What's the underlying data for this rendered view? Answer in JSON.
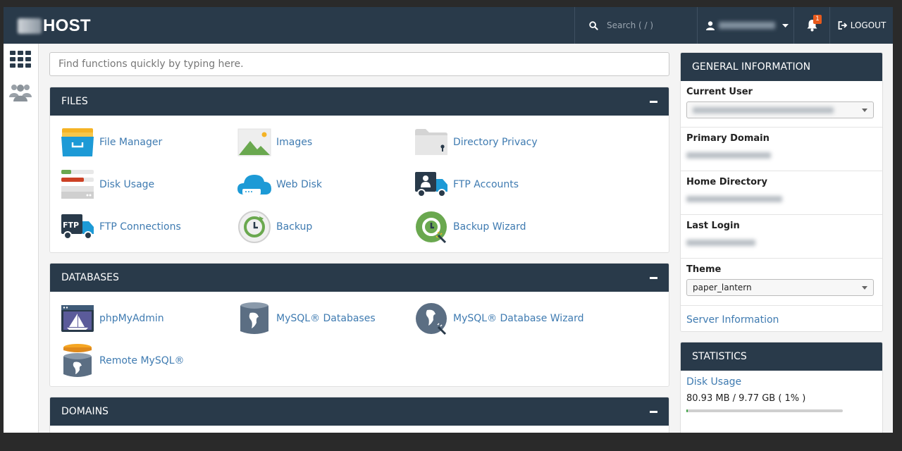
{
  "header": {
    "logo_text": "HOST",
    "search_placeholder": "Search ( / )",
    "notification_count": "1",
    "logout_label": "LOGOUT"
  },
  "quick_search": {
    "placeholder": "Find functions quickly by typing here."
  },
  "sections": {
    "files": {
      "title": "FILES",
      "items": [
        "File Manager",
        "Images",
        "Directory Privacy",
        "Disk Usage",
        "Web Disk",
        "FTP Accounts",
        "FTP Connections",
        "Backup",
        "Backup Wizard"
      ]
    },
    "databases": {
      "title": "DATABASES",
      "items": [
        "phpMyAdmin",
        "MySQL® Databases",
        "MySQL® Database Wizard",
        "Remote MySQL®"
      ]
    },
    "domains": {
      "title": "DOMAINS"
    }
  },
  "general_info": {
    "title": "GENERAL INFORMATION",
    "current_user_label": "Current User",
    "primary_domain_label": "Primary Domain",
    "home_directory_label": "Home Directory",
    "last_login_label": "Last Login",
    "theme_label": "Theme",
    "theme_value": "paper_lantern",
    "server_info_link": "Server Information"
  },
  "statistics": {
    "title": "STATISTICS",
    "disk_usage_link": "Disk Usage",
    "disk_usage_text": "80.93 MB / 9.77 GB ( 1% )",
    "disk_usage_percent": 1
  },
  "colors": {
    "navy": "#293a4a",
    "link": "#3f7bb1",
    "success": "#37a23f"
  }
}
